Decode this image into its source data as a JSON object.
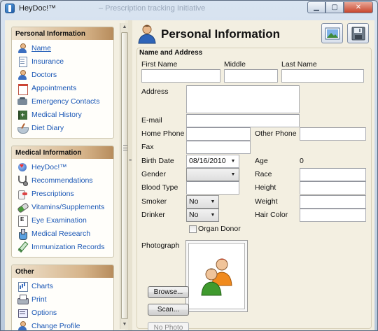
{
  "window": {
    "title": "HeyDoc!™",
    "ghost_title": "– Prescription tracking Initiative"
  },
  "sidebar": {
    "groups": [
      {
        "title": "Personal Information",
        "items": [
          {
            "label": "Name",
            "icon": "person-icon"
          },
          {
            "label": "Insurance",
            "icon": "document-icon"
          },
          {
            "label": "Doctors",
            "icon": "doctor-icon"
          },
          {
            "label": "Appointments",
            "icon": "calendar-icon"
          },
          {
            "label": "Emergency Contacts",
            "icon": "phone-icon"
          },
          {
            "label": "Medical History",
            "icon": "medical-book-icon"
          },
          {
            "label": "Diet Diary",
            "icon": "bowl-icon"
          }
        ]
      },
      {
        "title": "Medical Information",
        "items": [
          {
            "label": "HeyDoc!™",
            "icon": "heydoc-icon"
          },
          {
            "label": "Recommendations",
            "icon": "stethoscope-icon"
          },
          {
            "label": "Prescriptions",
            "icon": "pill-bottle-icon"
          },
          {
            "label": "Vitamins/Supplements",
            "icon": "capsule-icon"
          },
          {
            "label": "Eye Examination",
            "icon": "eye-chart-icon"
          },
          {
            "label": "Medical Research",
            "icon": "flask-icon"
          },
          {
            "label": "Immunization Records",
            "icon": "syringe-icon"
          }
        ]
      },
      {
        "title": "Other",
        "items": [
          {
            "label": "Charts",
            "icon": "chart-icon"
          },
          {
            "label": "Print",
            "icon": "printer-icon"
          },
          {
            "label": "Options",
            "icon": "options-icon"
          },
          {
            "label": "Change Profile",
            "icon": "profile-icon"
          }
        ]
      }
    ]
  },
  "main": {
    "title": "Personal Information",
    "section": "Name and Address",
    "labels": {
      "first_name": "First Name",
      "middle": "Middle",
      "last_name": "Last Name",
      "address": "Address",
      "email": "E-mail",
      "home_phone": "Home Phone",
      "other_phone": "Other Phone",
      "fax": "Fax",
      "birth_date": "Birth Date",
      "age": "Age",
      "gender": "Gender",
      "race": "Race",
      "blood_type": "Blood Type",
      "height": "Height",
      "smoker": "Smoker",
      "weight": "Weight",
      "drinker": "Drinker",
      "hair_color": "Hair Color",
      "organ_donor": "Organ Donor",
      "photograph": "Photograph"
    },
    "values": {
      "first_name": "",
      "middle": "",
      "last_name": "",
      "address": "",
      "email": "",
      "home_phone": "",
      "other_phone": "",
      "fax": "",
      "birth_date": "08/16/2010",
      "age": "0",
      "gender": "",
      "race": "",
      "blood_type": "",
      "height": "",
      "smoker": "No",
      "weight": "",
      "drinker": "No",
      "hair_color": "",
      "organ_donor": false
    },
    "buttons": {
      "browse": "Browse...",
      "scan": "Scan...",
      "no_photo": "No Photo"
    }
  },
  "colors": {
    "link": "#1a57b6",
    "panel_bg": "#f3efe1",
    "group_header_end": "#b78c5c"
  }
}
